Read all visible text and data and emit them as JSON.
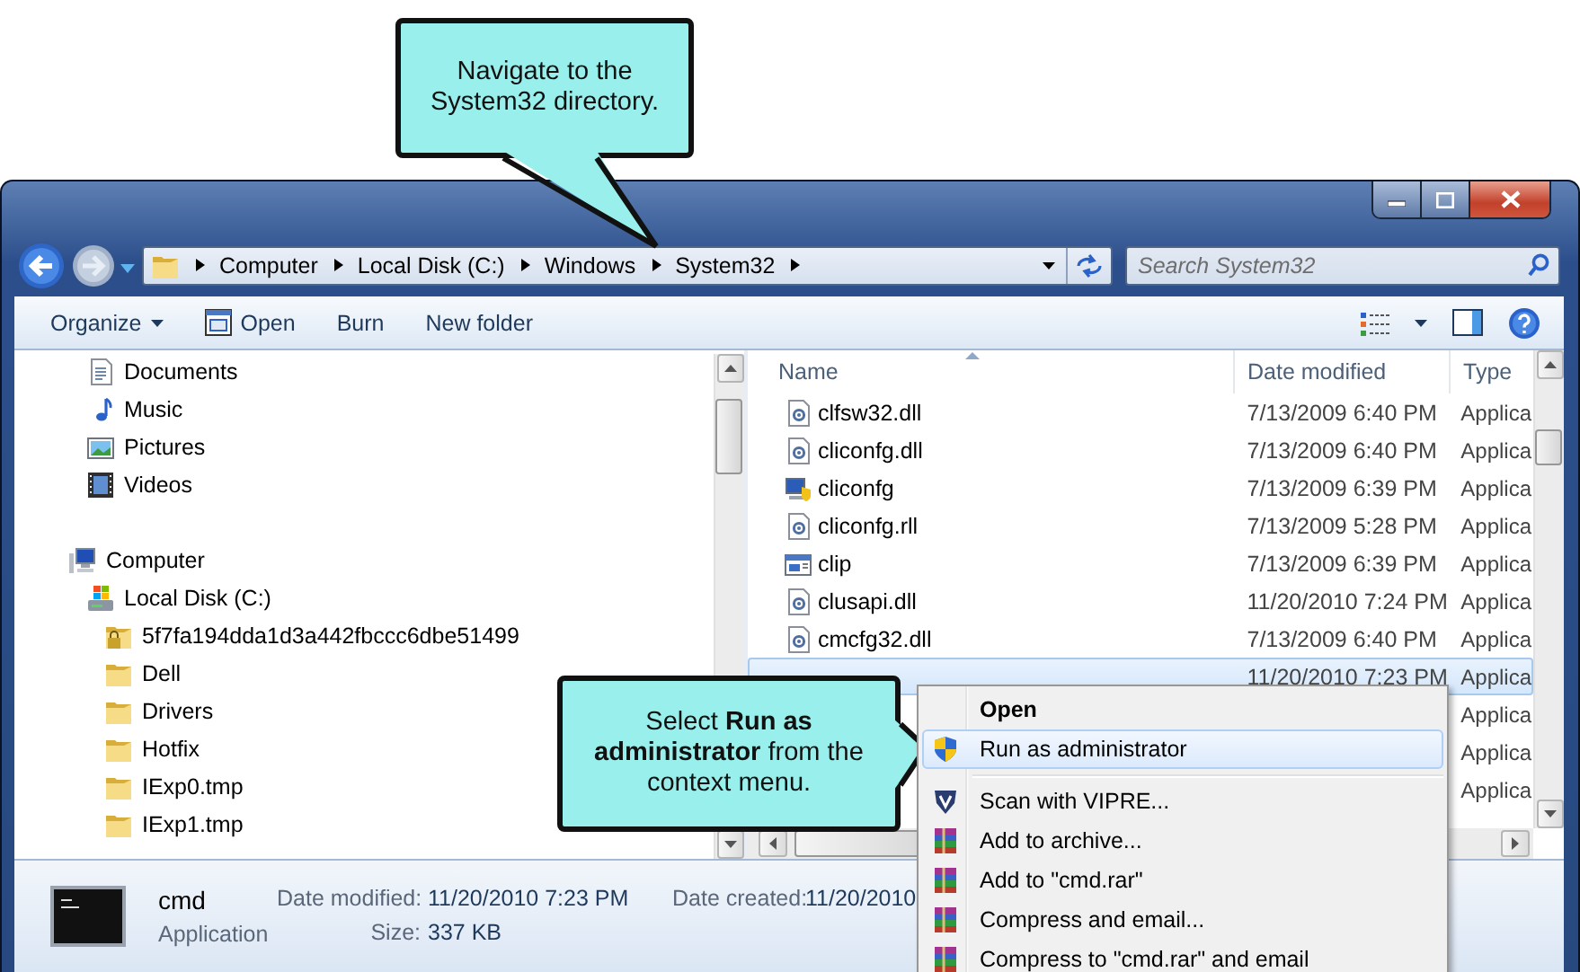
{
  "callouts": [
    {
      "kind": "above",
      "text": "Navigate to the System32 directory."
    },
    {
      "kind": "beside",
      "text": "Select **Run as administrator** from the context menu."
    }
  ],
  "address": {
    "path": [
      "Computer",
      "Local Disk (C:)",
      "Windows",
      "System32"
    ]
  },
  "search": {
    "placeholder": "Search System32"
  },
  "toolbar": [
    {
      "label": "Organize",
      "kind": "menu"
    },
    {
      "label": "Open",
      "kind": "app"
    },
    {
      "label": "Burn",
      "kind": "plain"
    },
    {
      "label": "New folder",
      "kind": "plain"
    }
  ],
  "navigation": {
    "libraries": [
      {
        "label": "Documents",
        "kind": "documents"
      },
      {
        "label": "Music",
        "kind": "music"
      },
      {
        "label": "Pictures",
        "kind": "pictures"
      },
      {
        "label": "Videos",
        "kind": "videos"
      }
    ],
    "computer": {
      "label": "Computer",
      "kind": "computer",
      "children": [
        {
          "label": "Local Disk (C:)",
          "kind": "drive",
          "children": [
            {
              "label": "5f7fa194dda1d3a442fbccc6dbe51499",
              "kind": "locked-folder"
            },
            {
              "label": "Dell",
              "kind": "folder"
            },
            {
              "label": "Drivers",
              "kind": "folder"
            },
            {
              "label": "Hotfix",
              "kind": "folder"
            },
            {
              "label": "IExp0.tmp",
              "kind": "folder"
            },
            {
              "label": "IExp1.tmp",
              "kind": "folder"
            }
          ]
        }
      ]
    }
  },
  "file_list": {
    "columns": [
      "Name",
      "Date modified",
      "Type"
    ],
    "rows": [
      {
        "name": "clfsw32.dll",
        "kind": "dll",
        "date": "7/13/2009 6:40 PM",
        "type": "Applica",
        "selected": false
      },
      {
        "name": "cliconfg.dll",
        "kind": "dll",
        "date": "7/13/2009 6:40 PM",
        "type": "Applica",
        "selected": false
      },
      {
        "name": "cliconfg",
        "kind": "app",
        "date": "7/13/2009 6:39 PM",
        "type": "Applica",
        "selected": false
      },
      {
        "name": "cliconfg.rll",
        "kind": "dll",
        "date": "7/13/2009 5:28 PM",
        "type": "Applica",
        "selected": false
      },
      {
        "name": "clip",
        "kind": "window",
        "date": "7/13/2009 6:39 PM",
        "type": "Applica",
        "selected": false
      },
      {
        "name": "clusapi.dll",
        "kind": "dll",
        "date": "11/20/2010 7:24 PM",
        "type": "Applica",
        "selected": false
      },
      {
        "name": "cmcfg32.dll",
        "kind": "dll",
        "date": "7/13/2009 6:40 PM",
        "type": "Applica",
        "selected": false
      },
      {
        "date": "11/20/2010 7:23 PM",
        "type": "Applica",
        "selected": true
      },
      {
        "type": "Applica",
        "selected": false
      },
      {
        "type": "Applica",
        "selected": false
      },
      {
        "type": "Applica",
        "selected": false
      }
    ]
  },
  "context_menu": [
    {
      "label": "Open",
      "kind": "default",
      "selected": false
    },
    {
      "label": "Run as administrator",
      "kind": "shield",
      "selected": true
    },
    {
      "kind": "separator"
    },
    {
      "label": "Scan with VIPRE...",
      "kind": "vipre",
      "selected": false
    },
    {
      "label": "Add to archive...",
      "kind": "archive",
      "selected": false
    },
    {
      "label": "Add to \"cmd.rar\"",
      "kind": "archive",
      "selected": false
    },
    {
      "label": "Compress and email...",
      "kind": "archive",
      "selected": false
    },
    {
      "label": "Compress to \"cmd.rar\" and email",
      "kind": "archive",
      "selected": false
    }
  ],
  "details": {
    "name": "cmd",
    "type": "Application",
    "fields": [
      {
        "label": "Date modified:",
        "value": "11/20/2010 7:23 PM"
      },
      {
        "label": "Date created:",
        "value": "11/20/2010"
      },
      {
        "label": "Size:",
        "value": "337 KB"
      }
    ]
  }
}
